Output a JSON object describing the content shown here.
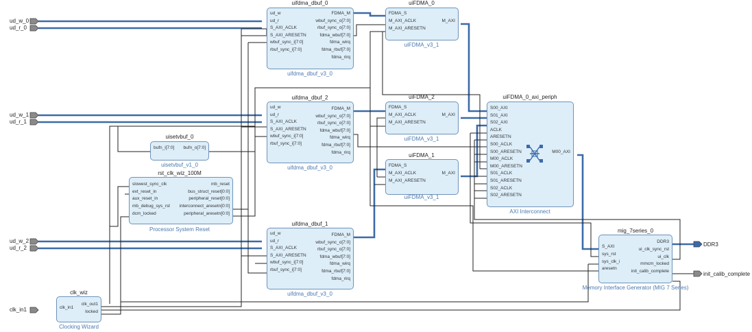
{
  "colors": {
    "block_fill": "#ddeef9",
    "block_border": "#6e92b9",
    "bus": "#3c6aa8",
    "wire": "#1f1f1f",
    "subtitle": "#4a78b0"
  },
  "ports": {
    "ud_w_0": "ud_w_0",
    "ud_r_0": "ud_r_0",
    "ud_w_1": "ud_w_1",
    "ud_r_1": "ud_r_1",
    "ud_w_2": "ud_w_2",
    "ud_r_2": "ud_r_2",
    "clk_in1": "clk_in1",
    "ddr3": "DDR3",
    "init_calib_complete": "init_calib_complete"
  },
  "blocks": {
    "dbuf0": {
      "title": "uifdma_dbuf_0",
      "subtitle": "uifdma_dbuf_v3_0",
      "left": [
        "ud_w",
        "ud_r",
        "S_AXI_ACLK",
        "S_AXI_ARESETN",
        "wbuf_sync_i[7:0]",
        "rbuf_sync_i[7:0]"
      ],
      "right": [
        "FDMA_M",
        "wbuf_sync_o[7:0]",
        "rbuf_sync_o[7:0]",
        "fdma_wbuf[7:0]",
        "fdma_wirq",
        "fdma_rbuf[7:0]",
        "fdma_rirq"
      ]
    },
    "dbuf2": {
      "title": "uifdma_dbuf_2",
      "subtitle": "uifdma_dbuf_v3_0",
      "left": [
        "ud_w",
        "ud_r",
        "S_AXI_ACLK",
        "S_AXI_ARESETN",
        "wbuf_sync_i[7:0]",
        "rbuf_sync_i[7:0]"
      ],
      "right": [
        "FDMA_M",
        "wbuf_sync_o[7:0]",
        "rbuf_sync_o[7:0]",
        "fdma_wbuf[7:0]",
        "fdma_wirq",
        "fdma_rbuf[7:0]",
        "fdma_rirq"
      ]
    },
    "dbuf1": {
      "title": "uifdma_dbuf_1",
      "subtitle": "uifdma_dbuf_v3_0",
      "left": [
        "ud_w",
        "ud_r",
        "S_AXI_ACLK",
        "S_AXI_ARESETN",
        "wbuf_sync_i[7:0]",
        "rbuf_sync_i[7:0]"
      ],
      "right": [
        "FDMA_M",
        "wbuf_sync_o[7:0]",
        "rbuf_sync_o[7:0]",
        "fdma_wbuf[7:0]",
        "fdma_wirq",
        "fdma_rbuf[7:0]",
        "fdma_rirq"
      ]
    },
    "fdma0": {
      "title": "uiFDMA_0",
      "subtitle": "uiFDMA_v3_1",
      "left": [
        "FDMA_S",
        "M_AXI_ACLK",
        "M_AXI_ARESETN"
      ],
      "right": [
        "M_AXI"
      ]
    },
    "fdma2": {
      "title": "uiFDMA_2",
      "subtitle": "uiFDMA_v3_1",
      "left": [
        "FDMA_S",
        "M_AXI_ACLK",
        "M_AXI_ARESETN"
      ],
      "right": [
        "M_AXI"
      ]
    },
    "fdma1": {
      "title": "uiFDMA_1",
      "subtitle": "uiFDMA_v3_1",
      "left": [
        "FDMA_S",
        "M_AXI_ACLK",
        "M_AXI_ARESETN"
      ],
      "right": [
        "M_AXI"
      ]
    },
    "setvbuf": {
      "title": "uisetvbuf_0",
      "subtitle": "uisetvbuf_v1_0",
      "left": [
        "bufn_i[7:0]"
      ],
      "right": [
        "bufn_o[7:0]"
      ]
    },
    "rst": {
      "title": "rst_clk_wiz_100M",
      "subtitle": "Processor System Reset",
      "left": [
        "slowest_sync_clk",
        "ext_reset_in",
        "aux_reset_in",
        "mb_debug_sys_rst",
        "dcm_locked"
      ],
      "right": [
        "mb_reset",
        "bus_struct_reset[0:0]",
        "peripheral_reset[0:0]",
        "interconnect_aresetn[0:0]",
        "peripheral_aresetn[0:0]"
      ]
    },
    "axi": {
      "title": "uiFDMA_0_axi_periph",
      "subtitle": "AXI Interconnect",
      "left": [
        "S00_AXI",
        "S01_AXI",
        "S02_AXI",
        "ACLK",
        "ARESETN",
        "S00_ACLK",
        "S00_ARESETN",
        "M00_ACLK",
        "M00_ARESETN",
        "S01_ACLK",
        "S01_ARESETN",
        "S02_ACLK",
        "S02_ARESETN"
      ],
      "right": [
        "M00_AXI"
      ]
    },
    "mig": {
      "title": "mig_7series_0",
      "subtitle": "Memory Interface Generator (MIG 7 Series)",
      "left": [
        "S_AXI",
        "sys_rst",
        "sys_clk_i",
        "aresetn"
      ],
      "right": [
        "DDR3",
        "ui_clk_sync_rst",
        "ui_clk",
        "mmcm_locked",
        "init_calib_complete"
      ]
    },
    "clkwiz": {
      "title": "clk_wiz",
      "subtitle": "Clocking Wizard",
      "left": [
        "clk_in1"
      ],
      "right": [
        "clk_out1",
        "locked"
      ]
    }
  }
}
